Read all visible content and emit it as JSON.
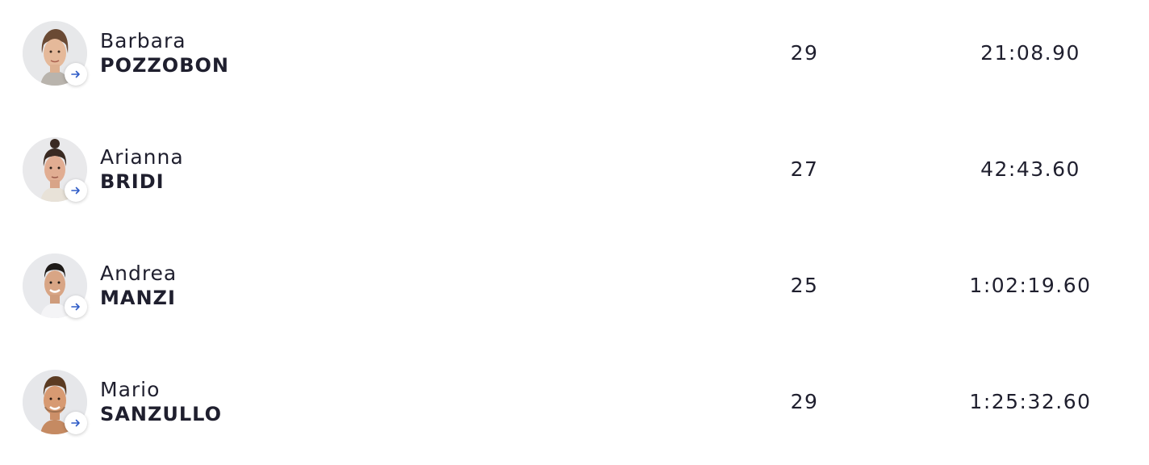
{
  "colors": {
    "text": "#1f1f2e",
    "arrow": "#2f5cc7",
    "avatar_bg": "#eceef1"
  },
  "athletes": [
    {
      "first_name": "Barbara",
      "last_name": "POZZOBON",
      "age": "29",
      "time": "21:08.90",
      "avatar": "woman-portrait",
      "action_icon": "arrow-right-icon"
    },
    {
      "first_name": "Arianna",
      "last_name": "BRIDI",
      "age": "27",
      "time": "42:43.60",
      "avatar": "woman-portrait",
      "action_icon": "arrow-right-icon"
    },
    {
      "first_name": "Andrea",
      "last_name": "MANZI",
      "age": "25",
      "time": "1:02:19.60",
      "avatar": "man-portrait",
      "action_icon": "arrow-right-icon"
    },
    {
      "first_name": "Mario",
      "last_name": "SANZULLO",
      "age": "29",
      "time": "1:25:32.60",
      "avatar": "man-portrait",
      "action_icon": "arrow-right-icon"
    }
  ]
}
